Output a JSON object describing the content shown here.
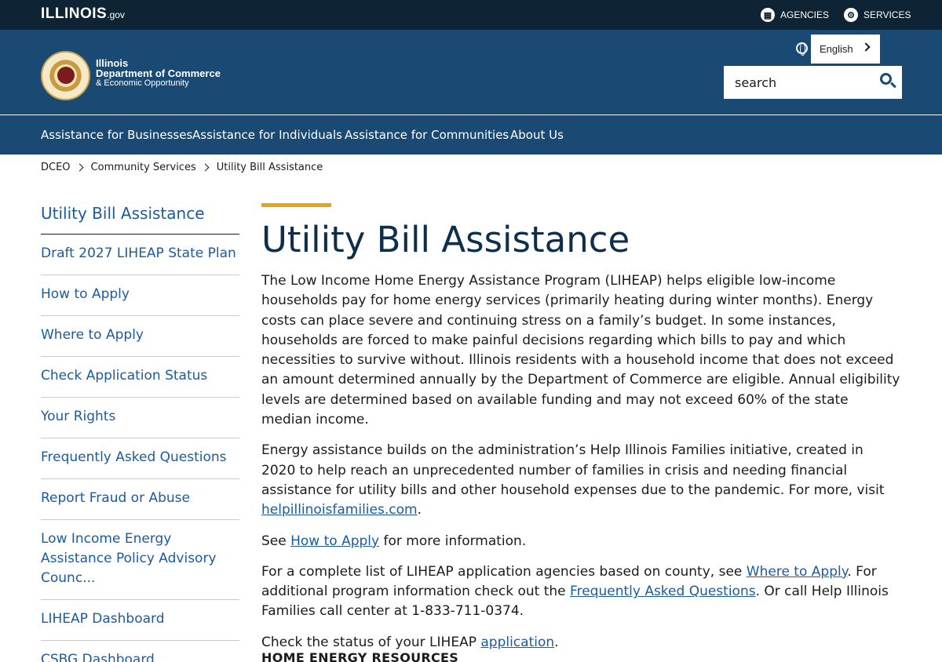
{
  "topbar": {
    "logo_main": "ILLINOIS",
    "logo_gov": ".gov",
    "agencies_label": "AGENCIES",
    "services_label": "SERVICES"
  },
  "header": {
    "dept_line1": "Illinois",
    "dept_line2": "Department of Commerce",
    "dept_line3": "& Economic Opportunity",
    "language": "English",
    "search_placeholder": "search"
  },
  "nav": {
    "items": [
      "Assistance for Businesses",
      "Assistance for Individuals",
      "Assistance for Communities",
      "About Us"
    ]
  },
  "breadcrumb": [
    "DCEO",
    "Community Services",
    "Utility Bill Assistance"
  ],
  "sidebar": {
    "title": "Utility Bill Assistance",
    "items": [
      "Draft 2027 LIHEAP State Plan",
      "How to Apply",
      "Where to Apply",
      "Check Application Status",
      "Your Rights",
      "Frequently Asked Questions",
      "Report Fraud or Abuse",
      "Low Income Energy Assistance Policy Advisory Counc...",
      "LIHEAP Dashboard",
      "CSBG Dashboard"
    ]
  },
  "main": {
    "title": "Utility Bill Assistance",
    "p1": "The Low Income Home Energy Assistance Program (LIHEAP) helps eligible low-income households pay for home energy services (primarily heating during winter months).  Energy costs can place severe and continuing stress on a family’s budget. In some instances, households are forced to make painful decisions regarding which bills to pay and which necessities to survive without.  Illinois residents with a household income that does not exceed an amount determined annually by the Department of Commerce are eligible. Annual eligibility levels are determined based on available funding and may not exceed 60% of the state median income.",
    "p2_text": "Energy assistance builds on the administration’s Help Illinois Families initiative, created in 2020 to help reach an unprecedented number of families in crisis and needing financial assistance for utility bills and other household expenses due to the pandemic. For more, visit ",
    "p2_link": "helpillinoisfamilies.com",
    "p2_end": ".",
    "p3_pre": "See ",
    "p3_link": "How to Apply",
    "p3_post": " for more information.",
    "p4_pre": "For a complete list of LIHEAP application agencies based on county, see ",
    "p4_link1": "Where to Apply",
    "p4_mid": ".  For additional program information check out the ",
    "p4_link2": "Frequently Asked Questions",
    "p4_post": ". Or call Help Illinois Families call center at 1-833-711-0374.",
    "p5_pre": "Check the status of your LIHEAP ",
    "p5_link": "application",
    "p5_post": ".",
    "section_heading": "HOME ENERGY RESOURCES"
  },
  "colors": {
    "topbar": "#0e2435",
    "header": "#1a4a73",
    "link": "#1a5b9e",
    "accent": "#e3a51a"
  }
}
